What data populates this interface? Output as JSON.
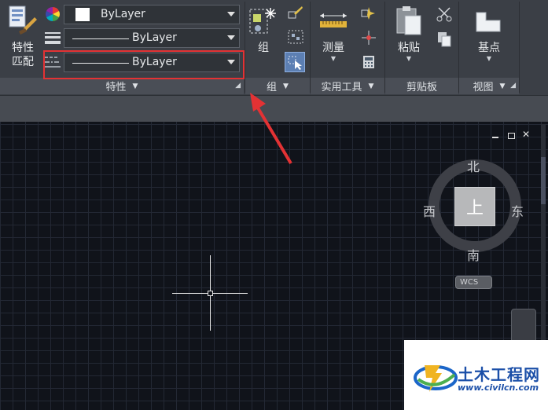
{
  "ribbon": {
    "match_properties_label": "特性\n匹配",
    "color_combo": "ByLayer",
    "lineweight_combo": "ByLayer",
    "linetype_combo": "ByLayer",
    "properties_footer": "特性",
    "group_label": "组",
    "group_footer": "组",
    "measure_label": "测量",
    "utilities_footer": "实用工具",
    "paste_label": "粘贴",
    "clipboard_footer": "剪贴板",
    "base_label": "基点",
    "view_footer": "视图"
  },
  "viewcube": {
    "north": "北",
    "south": "南",
    "east": "东",
    "west": "西",
    "face": "上",
    "wcs": "WCS"
  },
  "watermark": {
    "brand": "土木工程网",
    "url": "www.civilcn.com"
  },
  "colors": {
    "highlight": "#e33234",
    "arrow": "#e33234",
    "ribbon_bg": "#3b3f46",
    "canvas_bg": "#10131a",
    "brand_blue": "#1b66c9"
  }
}
